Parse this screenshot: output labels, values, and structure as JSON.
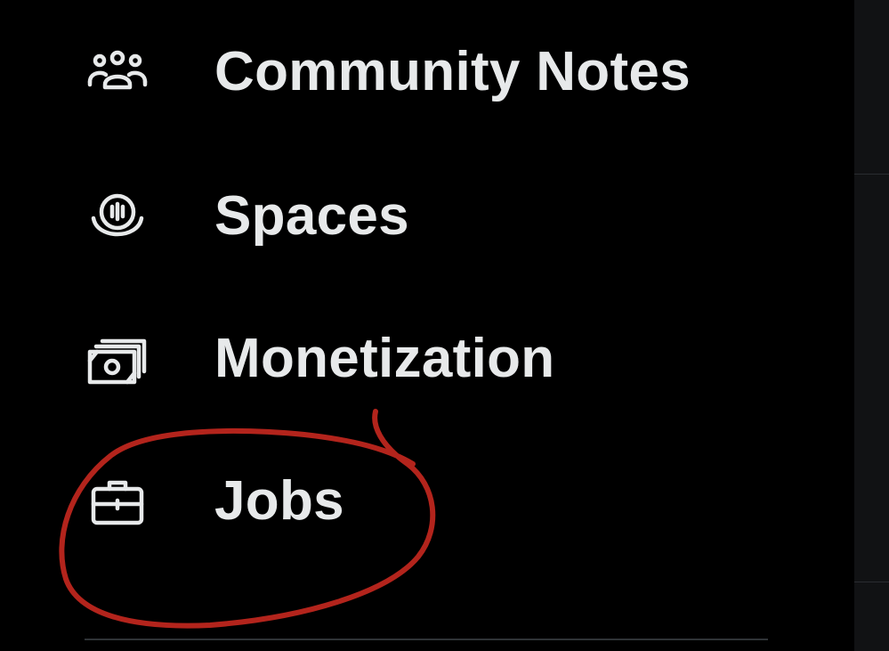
{
  "nav": {
    "items": [
      {
        "label": "Community Notes",
        "icon": "community-notes-icon"
      },
      {
        "label": "Spaces",
        "icon": "spaces-icon"
      },
      {
        "label": "Monetization",
        "icon": "monetization-icon"
      },
      {
        "label": "Jobs",
        "icon": "jobs-icon"
      }
    ]
  },
  "colors": {
    "background": "#000000",
    "text": "#e7e9ea",
    "divider": "#2f3336",
    "annotation": "#b3241c"
  }
}
